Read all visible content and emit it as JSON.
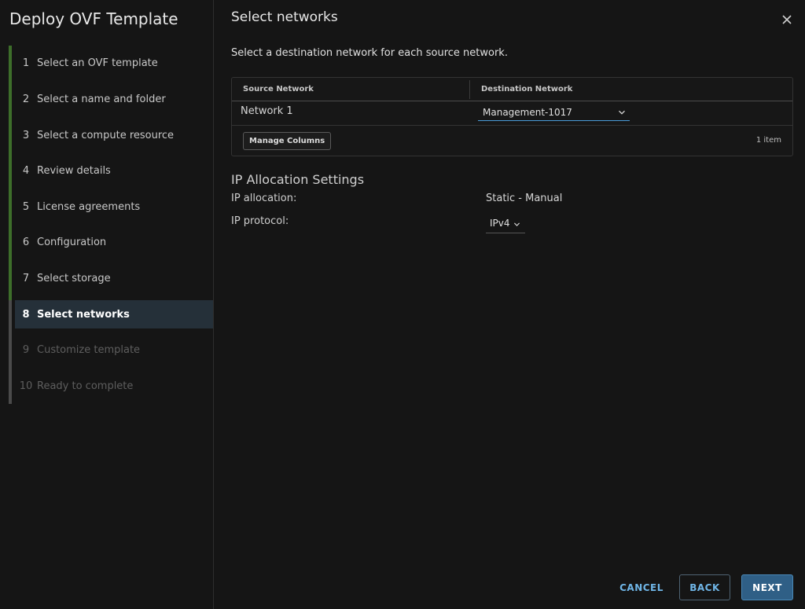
{
  "wizard": {
    "title": "Deploy OVF Template",
    "steps": [
      {
        "num": "1",
        "label": "Select an OVF template",
        "state": "done"
      },
      {
        "num": "2",
        "label": "Select a name and folder",
        "state": "done"
      },
      {
        "num": "3",
        "label": "Select a compute resource",
        "state": "done"
      },
      {
        "num": "4",
        "label": "Review details",
        "state": "done"
      },
      {
        "num": "5",
        "label": "License agreements",
        "state": "done"
      },
      {
        "num": "6",
        "label": "Configuration",
        "state": "done"
      },
      {
        "num": "7",
        "label": "Select storage",
        "state": "done"
      },
      {
        "num": "8",
        "label": "Select networks",
        "state": "active"
      },
      {
        "num": "9",
        "label": "Customize template",
        "state": "disabled"
      },
      {
        "num": "10",
        "label": "Ready to complete",
        "state": "disabled"
      }
    ]
  },
  "page": {
    "title": "Select networks",
    "intro": "Select a destination network for each source network."
  },
  "grid": {
    "columns": [
      "Source Network",
      "Destination Network"
    ],
    "rows": [
      {
        "source": "Network 1",
        "destination": "Management-1017"
      }
    ],
    "manage_columns_label": "Manage Columns",
    "item_count": "1 item"
  },
  "ip_settings": {
    "heading": "IP Allocation Settings",
    "allocation_label": "IP allocation:",
    "allocation_value": "Static - Manual",
    "protocol_label": "IP protocol:",
    "protocol_value": "IPv4"
  },
  "footer": {
    "cancel_label": "CANCEL",
    "back_label": "BACK",
    "next_label": "NEXT"
  },
  "colors": {
    "progress_done": "#3d6e2a",
    "active_step_bg": "#253039",
    "accent": "#6fb5e6",
    "primary_button": "#2f5f86"
  },
  "icons": {
    "close": "close-icon",
    "dropdown": "chevron-down-icon"
  }
}
